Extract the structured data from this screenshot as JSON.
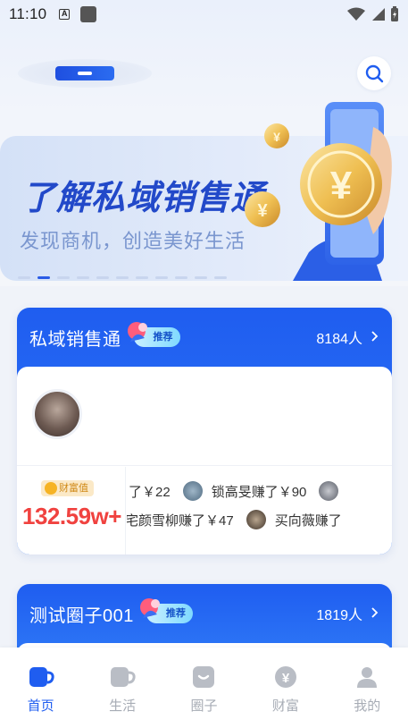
{
  "status_bar": {
    "time": "11:10",
    "icon_a": "A"
  },
  "banner": {
    "title": "了解私域销售通",
    "subtitle": "发现商机，创造美好生活",
    "slides": 11,
    "active_slide": 2
  },
  "cards": [
    {
      "title": "私域销售通",
      "badge": "推荐",
      "member_count": "8184人",
      "wealth_label": "财富值",
      "wealth_value": "132.59w+",
      "ticker_row1": [
        {
          "text": "了￥22"
        },
        {
          "text": "锁高旻赚了￥90"
        },
        {
          "text": ""
        }
      ],
      "ticker_row2": [
        {
          "text": "宅颜雪柳赚了￥47"
        },
        {
          "text": "买向薇赚了"
        }
      ]
    },
    {
      "title": "测试圈子001",
      "badge": "推荐",
      "member_count": "1819人"
    }
  ],
  "bottom_nav": [
    {
      "label": "首页",
      "icon": "home-cup-icon",
      "active": true
    },
    {
      "label": "生活",
      "icon": "life-cup-icon",
      "active": false
    },
    {
      "label": "圈子",
      "icon": "circle-chat-icon",
      "active": false
    },
    {
      "label": "财富",
      "icon": "yuan-coin-icon",
      "active": false
    },
    {
      "label": "我的",
      "icon": "profile-icon",
      "active": false
    }
  ],
  "colors": {
    "primary": "#1f5df0",
    "wealth_red": "#f0423f",
    "nav_inactive": "#a7acb5"
  }
}
